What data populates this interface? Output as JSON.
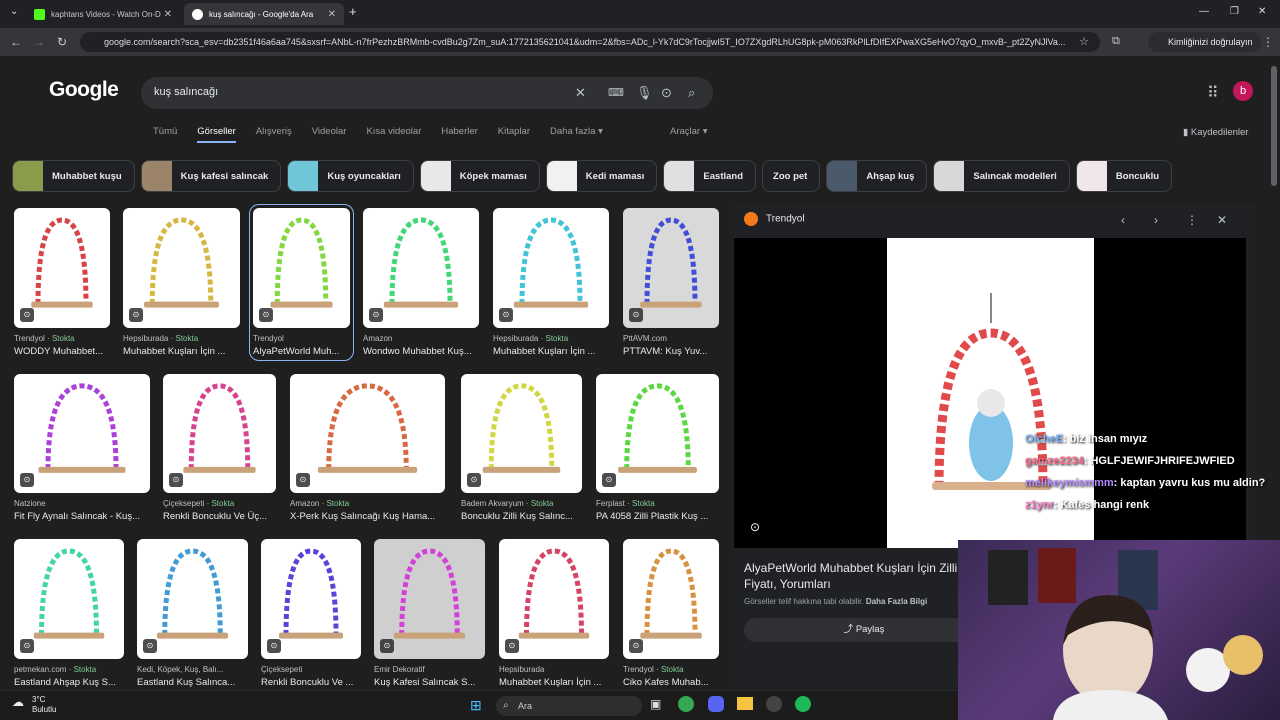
{
  "tabs": [
    {
      "title": "kaphtans Videos - Watch On-D",
      "color": "#53fc18"
    },
    {
      "title": "kuş salıncağı - Google'da Ara",
      "color": "#ffffff"
    }
  ],
  "address": {
    "url": "google.com/search?sca_esv=db2351f46a6aa745&sxsrf=ANbL-n7frPezhzBRMmb-cvdBu2g7Zm_suA:1772135621041&udm=2&fbs=ADc_l-Yk7dC9rTocjjwI5T_IO7ZXgdRLhUG8pk-pM063RkPlLfDIfEXPwaXG5eHvO7qyO_mxvB-_pt2ZyNJlVa...",
    "profile_label": "Kimliğinizi doğrulayın"
  },
  "google": {
    "logo": "Google",
    "query": "kuş salıncağı",
    "avatar_letter": "b",
    "filters": [
      "Tümü",
      "Görseller",
      "Alışveriş",
      "Videolar",
      "Kısa videolar",
      "Haberler",
      "Kitaplar",
      "Daha fazla ▾"
    ],
    "tools": "Araçlar ▾",
    "saved": "Kaydedilenler"
  },
  "chips": [
    {
      "label": "Muhabbet kuşu",
      "thumb": "#8a9b4a"
    },
    {
      "label": "Kuş kafesi salıncak",
      "thumb": "#9c8468"
    },
    {
      "label": "Kuş oyuncakları",
      "thumb": "#6ec6d8"
    },
    {
      "label": "Köpek maması",
      "thumb": "#e8e8e8"
    },
    {
      "label": "Kedi maması",
      "thumb": "#f1f1f1"
    },
    {
      "label": "Eastland",
      "thumb": "#e0e0e0"
    },
    {
      "label": "Zoo pet",
      "thumb": ""
    },
    {
      "label": "Ahşap kuş",
      "thumb": "#4a5a6a"
    },
    {
      "label": "Salıncak modelleri",
      "thumb": "#d8d8d8"
    },
    {
      "label": "Boncuklu",
      "thumb": "#f0e8e8"
    }
  ],
  "results": [
    {
      "source": "Trendyol",
      "stock": "Stokta",
      "title": "WODDY Muhabbet...",
      "color": "#ffffff"
    },
    {
      "source": "Hepsiburada",
      "stock": "Stokta",
      "title": "Muhabbet Kuşları İçin ...",
      "color": "#ffffff"
    },
    {
      "source": "Trendyol",
      "stock": "",
      "title": "AlyaPetWorld Muh...",
      "color": "#ffffff"
    },
    {
      "source": "Amazon",
      "stock": "",
      "title": "Wondwo Muhabbet Kuş...",
      "color": "#ffffff"
    },
    {
      "source": "Hepsiburada",
      "stock": "Stokta",
      "title": "Muhabbet Kuşları İçin ...",
      "color": "#ffffff"
    },
    {
      "source": "PttAVM.com",
      "stock": "",
      "title": "PTTAVM: Kuş Yuv...",
      "color": "#d9d9d9"
    },
    {
      "source": "Natzione",
      "stock": "",
      "title": "Fit Fly Aynalı Salıncak - Kuş...",
      "color": "#ffffff"
    },
    {
      "source": "Çiçeksepeti",
      "stock": "Stokta",
      "title": "Renkli Boncuklu Ve Üç...",
      "color": "#ffffff"
    },
    {
      "source": "Amazon",
      "stock": "Stokta",
      "title": "X-Perk Kuş Salıncağı Kuş Hama...",
      "color": "#ffffff"
    },
    {
      "source": "Badem Akvaryum",
      "stock": "Stokta",
      "title": "Boncuklu Zilli Kuş Salınc...",
      "color": "#ffffff"
    },
    {
      "source": "Ferplast",
      "stock": "Stokta",
      "title": "PA 4058 Zilli Plastik Kuş ...",
      "color": "#ffffff"
    },
    {
      "source": "petmekan.com",
      "stock": "Stokta",
      "title": "Eastland Ahşap Kuş S...",
      "color": "#ffffff"
    },
    {
      "source": "Kedi, Köpek, Kuş, Balı...",
      "stock": "",
      "title": "Eastland Kuş Salınca...",
      "color": "#ffffff"
    },
    {
      "source": "Çiçeksepeti",
      "stock": "",
      "title": "Renkli Boncuklu Ve ...",
      "color": "#ffffff"
    },
    {
      "source": "Emir Dekoratif",
      "stock": "",
      "title": "Kuş Kafesi Salıncak S...",
      "color": "#cfcfcf"
    },
    {
      "source": "Hepsiburada",
      "stock": "",
      "title": "Muhabbet Kuşları İçin ...",
      "color": "#ffffff"
    },
    {
      "source": "Trendyol",
      "stock": "Stokta",
      "title": "Ciko Kafes Muhab...",
      "color": "#ffffff"
    }
  ],
  "panel": {
    "source": "Trendyol",
    "title": "AlyaPetWorld Muhabbet Kuşları İçin Zilli Fiyatı, Yorumları",
    "note": "Görseller telif hakkına tabi olabilir.",
    "note_link": "Daha Fazla Bilgi",
    "share": "Paylaş"
  },
  "chat": [
    {
      "user": "OicheE",
      "msg": ": biz insan mıyız"
    },
    {
      "user": "gamze2234",
      "msg": ": HGLFJEWIFJHRIFEJWFIED"
    },
    {
      "user": "melikeymismmm",
      "msg": ": kaptan yavru kus mu aldin?"
    },
    {
      "user": "z1ynr",
      "msg": ": Kafes hangi renk"
    }
  ],
  "taskbar": {
    "temp": "3°C",
    "condition": "Bulutlu",
    "search": "Ara"
  }
}
